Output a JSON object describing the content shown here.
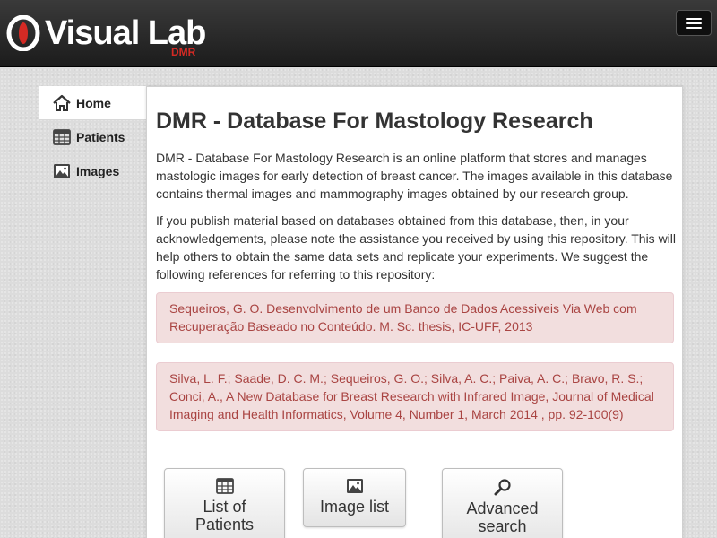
{
  "header": {
    "brand_name": "Visual Lab",
    "brand_sub": "DMR",
    "menu_icon": "hamburger-icon"
  },
  "sidebar": {
    "items": [
      {
        "label": "Home",
        "icon": "home-icon",
        "active": true
      },
      {
        "label": "Patients",
        "icon": "table-icon",
        "active": false
      },
      {
        "label": "Images",
        "icon": "image-icon",
        "active": false
      }
    ]
  },
  "main": {
    "title": "DMR - Database For Mastology Research",
    "intro": "DMR - Database For Mastology Research is an online platform that stores and manages mastologic images for early detection of breast cancer. The images available in this database contains thermal images and mammography images obtained by our research group.",
    "publish_note": "If you publish material based on databases obtained from this database, then, in your acknowledgements, please note the assistance you received by using this repository. This will help others to obtain the same data sets and replicate your experiments. We suggest the following references for referring to this repository:",
    "references": [
      "Sequeiros, G. O. Desenvolvimento de um Banco de Dados Acessiveis Via Web com Recuperação Baseado no Conteúdo. M. Sc. thesis, IC-UFF, 2013",
      "Silva, L. F.; Saade, D. C. M.; Sequeiros, G. O.; Silva, A. C.; Paiva, A. C.; Bravo, R. S.; Conci, A., A New Database for Breast Research with Infrared Image, Journal of Medical Imaging and Health Informatics, Volume 4, Number 1, March 2014 , pp. 92-100(9)"
    ],
    "buttons": [
      {
        "line1": "List of",
        "line2": "Patients",
        "icon": "table-icon"
      },
      {
        "line1": "Image list",
        "line2": "",
        "icon": "image-icon"
      },
      {
        "line1": "Advanced",
        "line2": "search",
        "icon": "search-icon"
      }
    ]
  },
  "colors": {
    "accent": "#d42a24",
    "alert_bg": "#f2dede",
    "alert_text": "#a94442",
    "navbar": "#2a2a2a"
  }
}
